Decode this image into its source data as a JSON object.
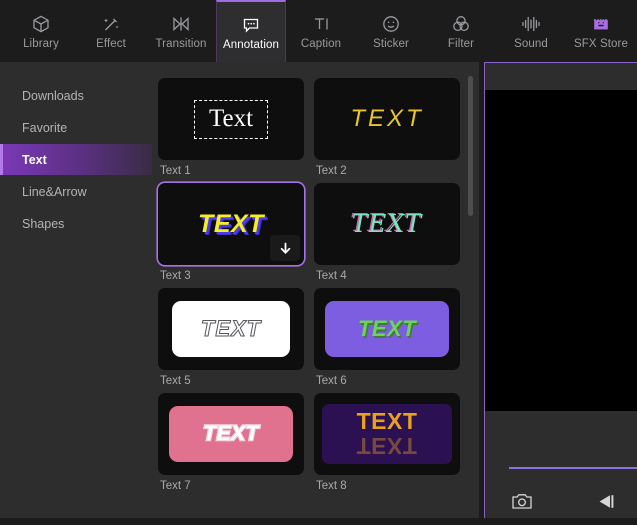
{
  "toolbar": {
    "items": [
      {
        "label": "Library",
        "icon": "cube-icon",
        "active": false
      },
      {
        "label": "Effect",
        "icon": "magic-wand-icon",
        "active": false
      },
      {
        "label": "Transition",
        "icon": "transition-icon",
        "active": false
      },
      {
        "label": "Annotation",
        "icon": "speech-bubble-icon",
        "active": true
      },
      {
        "label": "Caption",
        "icon": "text-cursor-icon",
        "active": false
      },
      {
        "label": "Sticker",
        "icon": "smiley-icon",
        "active": false
      },
      {
        "label": "Filter",
        "icon": "color-circles-icon",
        "active": false
      },
      {
        "label": "Sound",
        "icon": "waveform-icon",
        "active": false
      },
      {
        "label": "SFX Store",
        "icon": "storefront-icon",
        "active": false
      }
    ]
  },
  "sidebar": {
    "items": [
      {
        "label": "Downloads",
        "active": false
      },
      {
        "label": "Favorite",
        "active": false
      },
      {
        "label": "Text",
        "active": true
      },
      {
        "label": "Line&Arrow",
        "active": false
      },
      {
        "label": "Shapes",
        "active": false
      }
    ]
  },
  "grid": {
    "download_icon": "download-arrow-icon",
    "items": [
      {
        "caption": "Text 1",
        "sample": "Text",
        "style": "t1",
        "selected": false,
        "downloaded": true
      },
      {
        "caption": "Text 2",
        "sample": "TEXT",
        "style": "t2",
        "selected": false,
        "downloaded": true
      },
      {
        "caption": "Text 3",
        "sample": "TEXT",
        "style": "t3",
        "selected": true,
        "downloaded": false
      },
      {
        "caption": "Text 4",
        "sample": "TEXT",
        "style": "t4",
        "selected": false,
        "downloaded": true
      },
      {
        "caption": "Text 5",
        "sample": "TEXT",
        "style": "t5",
        "selected": false,
        "downloaded": true
      },
      {
        "caption": "Text 6",
        "sample": "TEXT",
        "style": "t6",
        "selected": false,
        "downloaded": true
      },
      {
        "caption": "Text 7",
        "sample": "TEXT",
        "style": "t7",
        "selected": false,
        "downloaded": true
      },
      {
        "caption": "Text 8",
        "sample": "TEXT",
        "style": "t8",
        "selected": false,
        "downloaded": true
      }
    ]
  },
  "preview": {
    "snapshot_icon": "camera-icon",
    "prev_frame_icon": "previous-frame-icon",
    "progress_percent": 100
  },
  "colors": {
    "accent": "#a872e8",
    "accent_border": "#8a63c8",
    "panel_bg": "#2d2d2d",
    "window_bg": "#1c1c1c",
    "thumb_bg": "#0e0e0e",
    "selected_gradient_start": "#7a39b8",
    "track": "#8b72e0"
  }
}
